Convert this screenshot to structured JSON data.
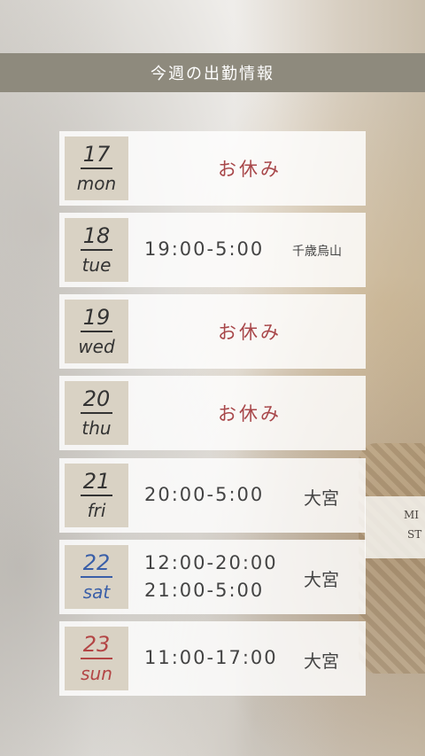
{
  "title": "今週の出勤情報",
  "schedule": [
    {
      "date": "17",
      "day": "mon",
      "status": "お休み"
    },
    {
      "date": "18",
      "day": "tue",
      "times": [
        "19:00-5:00"
      ],
      "place": "千歳烏山"
    },
    {
      "date": "19",
      "day": "wed",
      "status": "お休み"
    },
    {
      "date": "20",
      "day": "thu",
      "status": "お休み"
    },
    {
      "date": "21",
      "day": "fri",
      "times": [
        "20:00-5:00"
      ],
      "place": "大宮"
    },
    {
      "date": "22",
      "day": "sat",
      "times": [
        "12:00-20:00",
        "21:00-5:00"
      ],
      "place": "大宮"
    },
    {
      "date": "23",
      "day": "sun",
      "times": [
        "11:00-17:00"
      ],
      "place": "大宮"
    }
  ],
  "background_card": {
    "line1": "MI",
    "line2": "ST"
  },
  "colors": {
    "title_bar": "#8e8a7d",
    "date_box": "#d9d2c4",
    "off_text": "#a8474a",
    "saturday": "#3a5fa8",
    "sunday": "#b34545"
  }
}
